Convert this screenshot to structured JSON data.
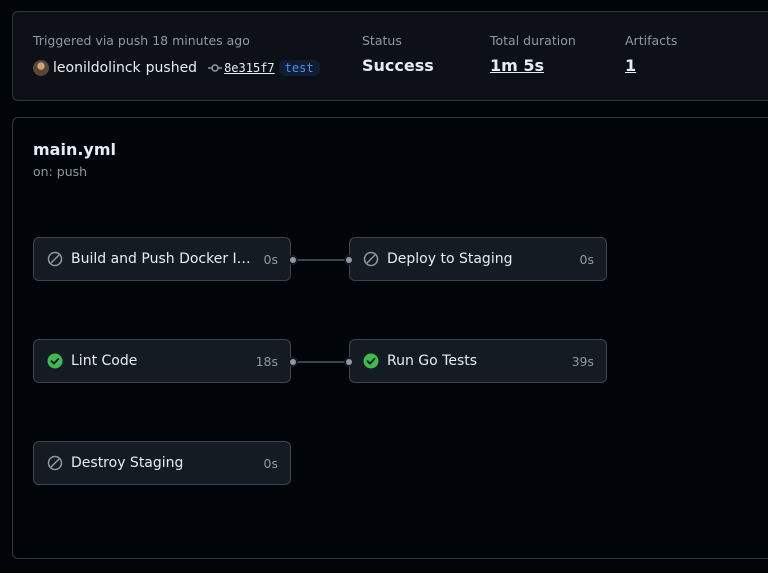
{
  "summary": {
    "triggered_text": "Triggered via push 18 minutes ago",
    "actor": "leonildolinck",
    "action": "pushed",
    "commit_sha": "8e315f7",
    "branch": "test",
    "status_label": "Status",
    "status_value": "Success",
    "duration_label": "Total duration",
    "duration_value": "1m 5s",
    "artifacts_label": "Artifacts",
    "artifacts_value": "1"
  },
  "workflow": {
    "name": "main.yml",
    "trigger": "on: push"
  },
  "jobs": [
    {
      "name": "Build and Push Docker Ima...",
      "duration": "0s",
      "status": "skipped"
    },
    {
      "name": "Deploy to Staging",
      "duration": "0s",
      "status": "skipped"
    },
    {
      "name": "Lint Code",
      "duration": "18s",
      "status": "success"
    },
    {
      "name": "Run Go Tests",
      "duration": "39s",
      "status": "success"
    },
    {
      "name": "Destroy Staging",
      "duration": "0s",
      "status": "skipped"
    }
  ],
  "icons": {
    "skipped": "skipped-icon",
    "success": "check-circle-icon",
    "commit": "git-commit-icon"
  },
  "colors": {
    "success": "#3fb950",
    "skipped": "#9198a1",
    "link": "#4493f8"
  }
}
